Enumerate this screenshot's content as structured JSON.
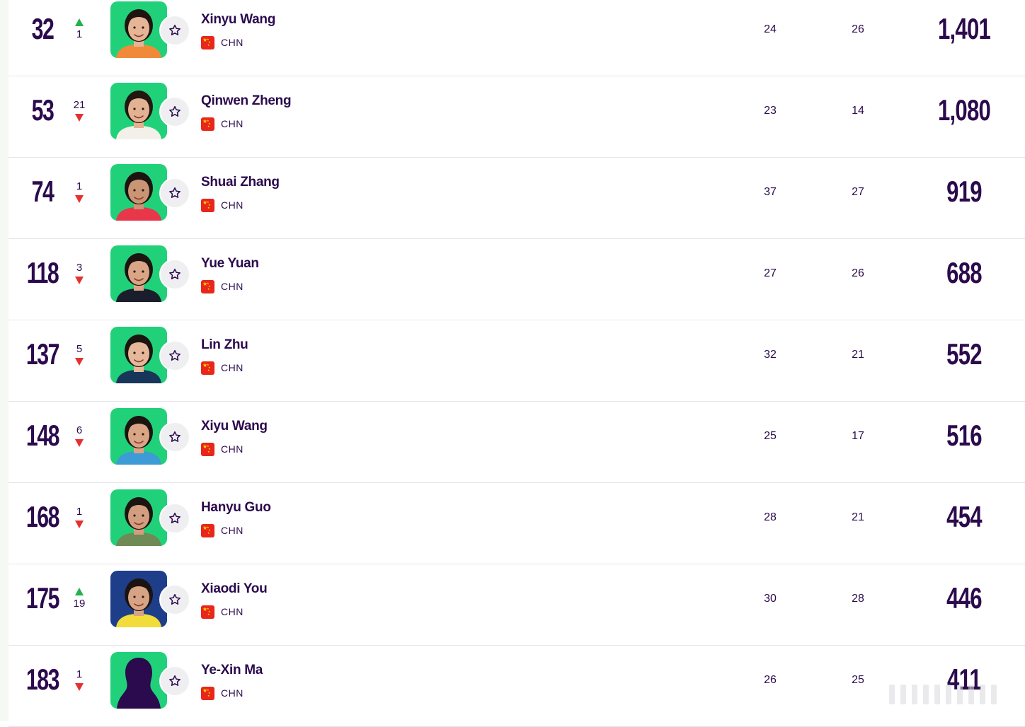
{
  "colors": {
    "text": "#2b0a4d",
    "up": "#21b24b",
    "down": "#e53030",
    "photo_bg": "#21d17a",
    "photo_bg_alt": "#1e3e8a",
    "flag": "#e8261b"
  },
  "icons": {
    "favorite": "star-outline-icon",
    "rise": "triangle-up-icon",
    "fall": "triangle-down-icon",
    "country": "china-flag-icon"
  },
  "players": [
    {
      "rank": "32",
      "move": "1",
      "dir": "up",
      "name": "Xinyu Wang",
      "country": "CHN",
      "age": "24",
      "played": "26",
      "points": "1,401",
      "shirt": "#f08a3a",
      "hair": "#1f1410",
      "skin": "#e6b595",
      "bg": "green"
    },
    {
      "rank": "53",
      "move": "21",
      "dir": "down",
      "name": "Qinwen Zheng",
      "country": "CHN",
      "age": "23",
      "played": "14",
      "points": "1,080",
      "shirt": "#f3f0ea",
      "hair": "#221711",
      "skin": "#e3b293",
      "bg": "green"
    },
    {
      "rank": "74",
      "move": "1",
      "dir": "down",
      "name": "Shuai Zhang",
      "country": "CHN",
      "age": "37",
      "played": "27",
      "points": "919",
      "shirt": "#e8364a",
      "hair": "#1b1410",
      "skin": "#c99574",
      "bg": "green"
    },
    {
      "rank": "118",
      "move": "3",
      "dir": "down",
      "name": "Yue Yuan",
      "country": "CHN",
      "age": "27",
      "played": "26",
      "points": "688",
      "shirt": "#1a1d2b",
      "hair": "#1b1410",
      "skin": "#d9a586",
      "bg": "green"
    },
    {
      "rank": "137",
      "move": "5",
      "dir": "down",
      "name": "Lin Zhu",
      "country": "CHN",
      "age": "32",
      "played": "21",
      "points": "552",
      "shirt": "#17365a",
      "hair": "#1b1410",
      "skin": "#e5b899",
      "bg": "green"
    },
    {
      "rank": "148",
      "move": "6",
      "dir": "down",
      "name": "Xiyu Wang",
      "country": "CHN",
      "age": "25",
      "played": "17",
      "points": "516",
      "shirt": "#3d9bd6",
      "hair": "#1b1410",
      "skin": "#d9a584",
      "bg": "green"
    },
    {
      "rank": "168",
      "move": "1",
      "dir": "down",
      "name": "Hanyu Guo",
      "country": "CHN",
      "age": "28",
      "played": "21",
      "points": "454",
      "shirt": "#6f8a55",
      "hair": "#1b1410",
      "skin": "#d29e7f",
      "bg": "green"
    },
    {
      "rank": "175",
      "move": "19",
      "dir": "up",
      "name": "Xiaodi You",
      "country": "CHN",
      "age": "30",
      "played": "28",
      "points": "446",
      "shirt": "#f1dc3a",
      "hair": "#1b1410",
      "skin": "#d7a385",
      "bg": "blue"
    },
    {
      "rank": "183",
      "move": "1",
      "dir": "down",
      "name": "Ye-Xin Ma",
      "country": "CHN",
      "age": "26",
      "played": "25",
      "points": "411",
      "shirt": "#2b0a4d",
      "hair": "#2b0a4d",
      "skin": "#2b0a4d",
      "bg": "green",
      "silhouette": true
    }
  ]
}
